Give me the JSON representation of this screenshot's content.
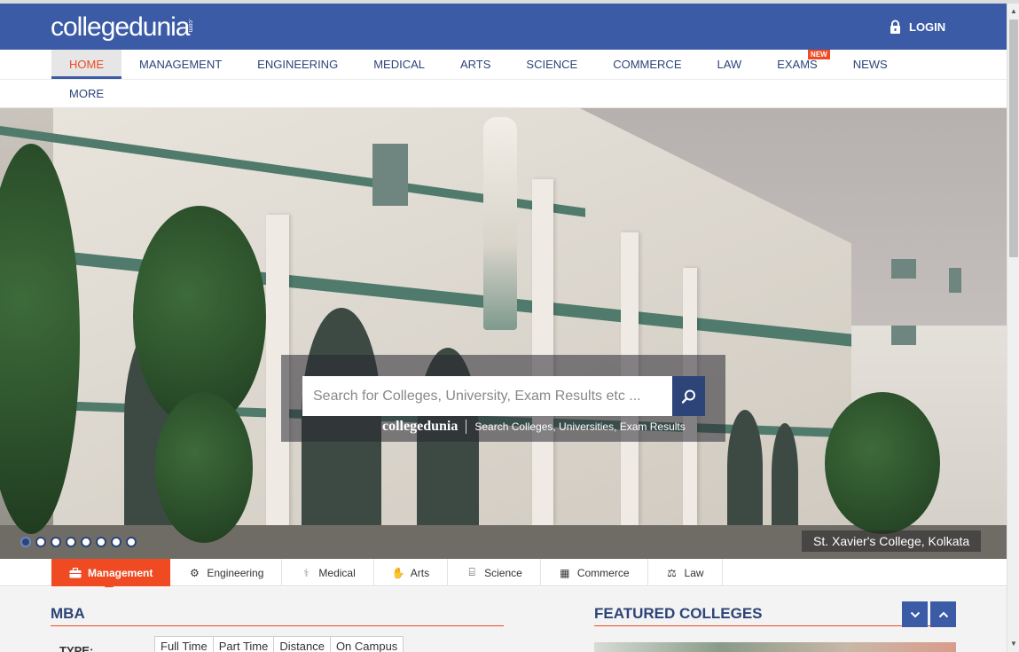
{
  "header": {
    "logo_text": "collegedunia",
    "logo_suffix": ".com",
    "login_label": "LOGIN",
    "login_icon": "lock-icon",
    "bg_color": "#3b5ba7"
  },
  "nav": {
    "items": [
      {
        "label": "HOME",
        "active": true
      },
      {
        "label": "MANAGEMENT"
      },
      {
        "label": "ENGINEERING"
      },
      {
        "label": "MEDICAL"
      },
      {
        "label": "ARTS"
      },
      {
        "label": "SCIENCE"
      },
      {
        "label": "COMMERCE"
      },
      {
        "label": "LAW"
      },
      {
        "label": "EXAMS",
        "badge": "NEW"
      },
      {
        "label": "NEWS"
      }
    ],
    "more_label": "MORE",
    "active_color": "#f04a23"
  },
  "hero": {
    "search_placeholder": "Search for Colleges, University, Exam Results etc ...",
    "search_brand": "collegedunia",
    "search_tagline": "Search Colleges, Universities, Exam Results",
    "search_icon": "search-icon",
    "slides_count": 8,
    "active_slide": 1,
    "caption": "St. Xavier's College, Kolkata"
  },
  "categories": {
    "tabs": [
      {
        "label": "Management",
        "icon": "briefcase-icon",
        "active": true
      },
      {
        "label": "Engineering",
        "icon": "gears-icon"
      },
      {
        "label": "Medical",
        "icon": "medical-icon"
      },
      {
        "label": "Arts",
        "icon": "hand-icon"
      },
      {
        "label": "Science",
        "icon": "microscope-icon"
      },
      {
        "label": "Commerce",
        "icon": "calculator-icon"
      },
      {
        "label": "Law",
        "icon": "scales-icon"
      }
    ]
  },
  "mba": {
    "title": "MBA",
    "type_label": "TYPE:",
    "type_options": [
      "Full Time",
      "Part Time",
      "Distance",
      "On Campus"
    ]
  },
  "featured": {
    "title": "FEATURED COLLEGES",
    "down_icon": "chevron-down-icon",
    "up_icon": "chevron-up-icon"
  }
}
